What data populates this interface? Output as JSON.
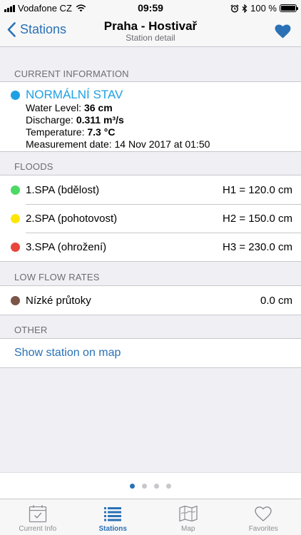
{
  "status_bar": {
    "carrier": "Vodafone CZ",
    "time": "09:59",
    "battery": "100 %"
  },
  "nav": {
    "back_label": "Stations",
    "title": "Praha - Hostivař",
    "subtitle": "Station detail"
  },
  "current": {
    "header": "CURRENT INFORMATION",
    "status": "NORMÁLNÍ STAV",
    "status_color": "#1ea1e3",
    "water_level_label": "Water Level:",
    "water_level_value": "36 cm",
    "discharge_label": "Discharge:",
    "discharge_value": "0.311 m³/s",
    "temperature_label": "Temperature:",
    "temperature_value": "7.3 °C",
    "measurement": "Measurement date: 14 Nov 2017 at 01:50"
  },
  "floods": {
    "header": "FLOODS",
    "items": [
      {
        "label": "1.SPA (bdělost)",
        "value": "H1 = 120.0 cm",
        "color": "#4cd964"
      },
      {
        "label": "2.SPA (pohotovost)",
        "value": "H2 = 150.0 cm",
        "color": "#ffe600"
      },
      {
        "label": "3.SPA (ohrožení)",
        "value": "H3 = 230.0 cm",
        "color": "#e8453c"
      }
    ]
  },
  "low_flow": {
    "header": "LOW FLOW RATES",
    "label": "Nízké průtoky",
    "value": "0.0 cm",
    "color": "#7b5548"
  },
  "other": {
    "header": "OTHER",
    "link": "Show station on map"
  },
  "pager": {
    "count": 4,
    "active": 1
  },
  "tabs": [
    {
      "label": "Current Info",
      "icon": "calendar-check-icon"
    },
    {
      "label": "Stations",
      "icon": "list-icon"
    },
    {
      "label": "Map",
      "icon": "map-icon"
    },
    {
      "label": "Favorites",
      "icon": "heart-outline-icon"
    }
  ],
  "colors": {
    "accent": "#2a71b5",
    "background": "#efeff4"
  }
}
